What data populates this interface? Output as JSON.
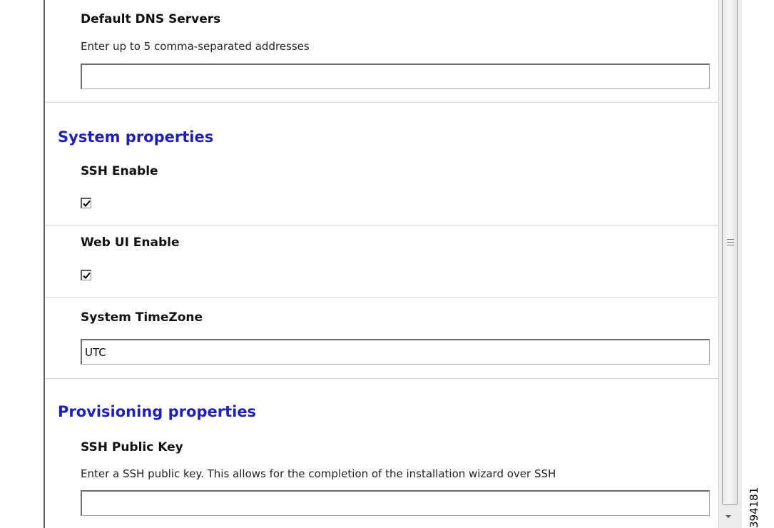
{
  "network": {
    "dns_title": "Default DNS Servers",
    "dns_description": "Enter up to 5 comma-separated addresses",
    "dns_value": ""
  },
  "system": {
    "section_title": "System properties",
    "ssh_enable_label": "SSH Enable",
    "ssh_enable_checked": true,
    "webui_enable_label": "Web UI Enable",
    "webui_enable_checked": true,
    "timezone_label": "System TimeZone",
    "timezone_value": "UTC"
  },
  "provisioning": {
    "section_title": "Provisioning properties",
    "ssh_key_label": "SSH Public Key",
    "ssh_key_description": "Enter a SSH public key. This allows for the completion of the installation wizard over SSH",
    "ssh_key_value": ""
  },
  "figure_id": "394181",
  "icons": {
    "checkmark": "check-icon",
    "scroll_grip": "grip-icon",
    "scroll_down": "arrow-down-icon"
  },
  "colors": {
    "section_heading": "#1f1fb8"
  }
}
